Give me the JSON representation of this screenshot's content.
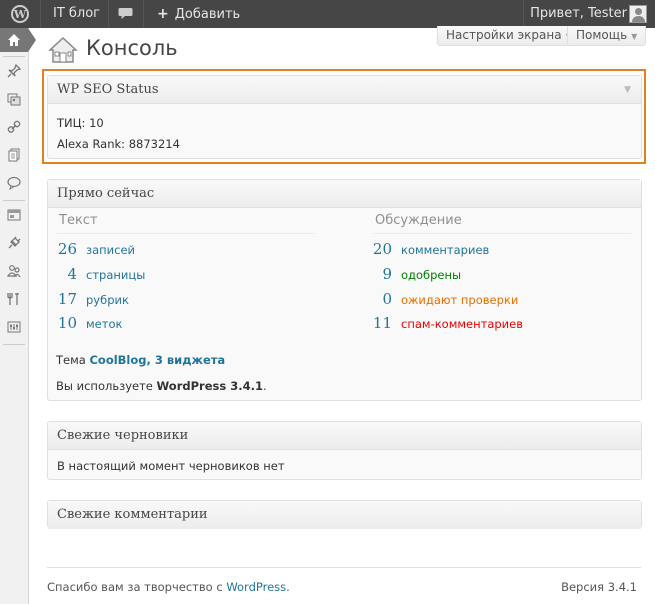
{
  "adminbar": {
    "site_name": "IT блог",
    "add_new": "Добавить",
    "greeting": "Привет, Tester"
  },
  "sidebar": {
    "items": [
      {
        "icon": "home-icon",
        "current": true
      },
      {
        "icon": "pin-icon"
      },
      {
        "icon": "media-icon"
      },
      {
        "icon": "links-icon"
      },
      {
        "icon": "pages-icon"
      },
      {
        "icon": "comments-icon"
      },
      {
        "icon": "appearance-icon"
      },
      {
        "icon": "plugins-icon"
      },
      {
        "icon": "users-icon"
      },
      {
        "icon": "tools-icon"
      },
      {
        "icon": "settings-icon"
      }
    ]
  },
  "header": {
    "title": "Консоль",
    "screen_options": "Настройки экрана",
    "help": "Помощь"
  },
  "seo_widget": {
    "title": "WP SEO Status",
    "tic": "ТИЦ: 10",
    "alexa": "Alexa Rank: 8873214"
  },
  "right_now": {
    "title": "Прямо сейчас",
    "content_heading": "Текст",
    "discussion_heading": "Обсуждение",
    "content": [
      {
        "num": "26",
        "label": "записей"
      },
      {
        "num": "4",
        "label": "страницы"
      },
      {
        "num": "17",
        "label": "рубрик"
      },
      {
        "num": "10",
        "label": "меток"
      }
    ],
    "discussion": [
      {
        "num": "20",
        "label": "комментариев"
      },
      {
        "num": "9",
        "label": "одобрены"
      },
      {
        "num": "0",
        "label": "ожидают проверки"
      },
      {
        "num": "11",
        "label": "спам-комментариев"
      }
    ],
    "theme_prefix": "Тема ",
    "theme_name": "CoolBlog",
    "theme_sep": ", ",
    "widgets": "3 виджета",
    "version_prefix": "Вы используете ",
    "version": "WordPress 3.4.1",
    "version_suffix": "."
  },
  "drafts_widget": {
    "title": "Свежие черновики",
    "empty": "В настоящий момент черновиков нет"
  },
  "comments_widget": {
    "title": "Свежие комментарии"
  },
  "footer": {
    "thanks_prefix": "Спасибо вам за творчество с ",
    "wp_link": "WordPress",
    "thanks_suffix": ".",
    "version": "Версия 3.4.1"
  },
  "colors": {
    "accent": "#21759b",
    "highlight": "#e57f24",
    "approved": "#008000",
    "pending": "#e66f00",
    "spam": "#e00000"
  }
}
